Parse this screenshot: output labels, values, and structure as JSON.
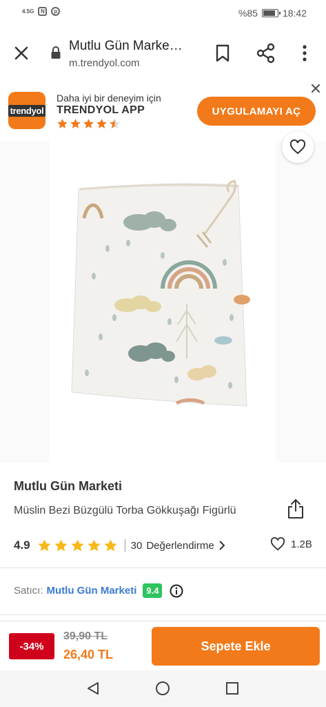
{
  "status_bar": {
    "network": "4.5G",
    "battery": "%85",
    "battery_level": 0.85,
    "time": "18:42"
  },
  "browser": {
    "title": "Mutlu Gün Marke…",
    "url": "m.trendyol.com"
  },
  "app_banner": {
    "logo_text": "trendyol",
    "line1": "Daha iyi bir deneyim için",
    "line2": "TRENDYOL APP",
    "rating_stars": 4.5,
    "open_button": "UYGULAMAYI AÇ"
  },
  "product": {
    "shop_name": "Mutlu Gün Marketi",
    "name": "Müslin Bezi Büzgülü Torba Gökkuşağı Figürlü",
    "rating": "4.9",
    "rating_stars": 5,
    "review_count": "30",
    "review_label": "Değerlendirme",
    "favorite_count": "1.2B",
    "seller_label": "Satıcı:",
    "seller_name": "Mutlu Gün Marketi",
    "seller_score": "9.4"
  },
  "action_bar": {
    "discount": "-34%",
    "old_price": "39,90 TL",
    "new_price": "26,40 TL",
    "add_to_cart": "Sepete Ekle"
  },
  "colors": {
    "brand_orange": "#f27a1a",
    "discount_red": "#d0021b",
    "seller_blue": "#3b7bd0",
    "score_green": "#2ec45e",
    "star_yellow": "#f9b81a"
  }
}
